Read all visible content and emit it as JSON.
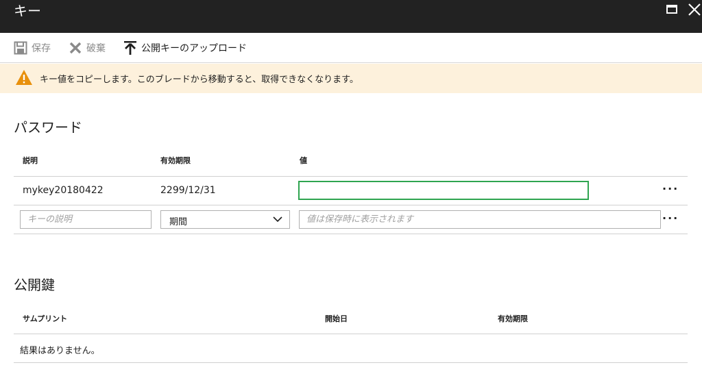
{
  "window": {
    "title": "キー"
  },
  "toolbar": {
    "save_label": "保存",
    "discard_label": "破棄",
    "upload_label": "公開キーのアップロード"
  },
  "warning": {
    "text": "キー値をコピーします。このブレードから移動すると、取得できなくなります。"
  },
  "passwords": {
    "title": "パスワード",
    "columns": [
      "説明",
      "有効期限",
      "値"
    ],
    "rows": [
      {
        "description": "mykey20180422",
        "expires": "2299/12/31",
        "value": ""
      }
    ],
    "new_row": {
      "description_placeholder": "キーの説明",
      "duration_selected": "期間",
      "value_placeholder": "値は保存時に表示されます"
    },
    "more_label": "···"
  },
  "public_keys": {
    "title": "公開鍵",
    "columns": [
      "サムプリント",
      "開始日",
      "有効期限"
    ],
    "empty_text": "結果はありません。"
  },
  "colors": {
    "accent_green": "#2ea44f",
    "warning_bg": "#fdf1dc",
    "warning_icon": "#e8900c",
    "titlebar": "#222222"
  }
}
